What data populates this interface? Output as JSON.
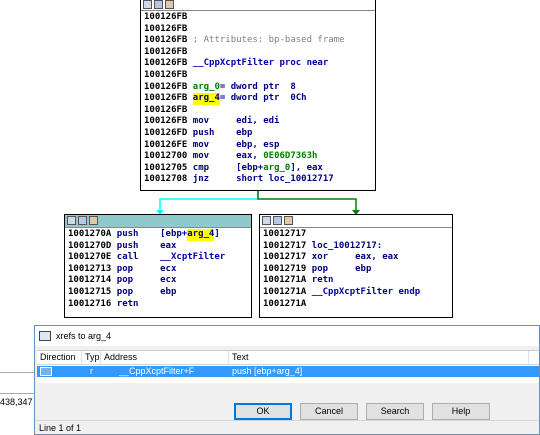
{
  "top_node": {
    "lines": [
      {
        "addr": "100126FB",
        "parts": []
      },
      {
        "addr": "100126FB",
        "parts": []
      },
      {
        "addr": "100126FB",
        "parts": [
          {
            "t": "; Attributes: bp-based frame",
            "c": "cmt"
          }
        ]
      },
      {
        "addr": "100126FB",
        "parts": []
      },
      {
        "addr": "100126FB",
        "parts": [
          {
            "t": "__CppXcptFilter proc near",
            "c": "proc"
          }
        ]
      },
      {
        "addr": "100126FB",
        "parts": []
      },
      {
        "addr": "100126FB",
        "parts": [
          {
            "t": "arg_0",
            "c": "num"
          },
          {
            "t": "= dword ptr  8",
            "c": "op"
          }
        ]
      },
      {
        "addr": "100126FB",
        "parts": [
          {
            "t": "arg_4",
            "c": "ylw"
          },
          {
            "t": "= dword ptr  0Ch",
            "c": "op"
          }
        ]
      },
      {
        "addr": "100126FB",
        "parts": []
      },
      {
        "addr": "100126FB",
        "parts": [
          {
            "t": "mov     edi, edi",
            "c": "mn"
          }
        ]
      },
      {
        "addr": "100126FD",
        "parts": [
          {
            "t": "push    ebp",
            "c": "mn"
          }
        ]
      },
      {
        "addr": "100126FE",
        "parts": [
          {
            "t": "mov     ebp, esp",
            "c": "mn"
          }
        ]
      },
      {
        "addr": "10012700",
        "parts": [
          {
            "t": "mov     eax, ",
            "c": "mn"
          },
          {
            "t": "0E06D7363h",
            "c": "num"
          }
        ]
      },
      {
        "addr": "10012705",
        "parts": [
          {
            "t": "cmp     [ebp+",
            "c": "mn"
          },
          {
            "t": "arg_0",
            "c": "num"
          },
          {
            "t": "], eax",
            "c": "mn"
          }
        ]
      },
      {
        "addr": "10012708",
        "parts": [
          {
            "t": "jnz     short loc_10012717",
            "c": "mn"
          }
        ]
      }
    ]
  },
  "left_node": {
    "lines": [
      {
        "addr": "1001270A",
        "parts": [
          {
            "t": "push    [ebp+",
            "c": "mn"
          },
          {
            "t": "arg_4",
            "c": "ylw"
          },
          {
            "t": "]",
            "c": "mn"
          }
        ]
      },
      {
        "addr": "1001270D",
        "parts": [
          {
            "t": "push    eax",
            "c": "mn"
          }
        ]
      },
      {
        "addr": "1001270E",
        "parts": [
          {
            "t": "call    ",
            "c": "mn"
          },
          {
            "t": "__XcptFilter",
            "c": "proc"
          }
        ]
      },
      {
        "addr": "10012713",
        "parts": [
          {
            "t": "pop     ecx",
            "c": "mn"
          }
        ]
      },
      {
        "addr": "10012714",
        "parts": [
          {
            "t": "pop     ecx",
            "c": "mn"
          }
        ]
      },
      {
        "addr": "10012715",
        "parts": [
          {
            "t": "pop     ebp",
            "c": "mn"
          }
        ]
      },
      {
        "addr": "10012716",
        "parts": [
          {
            "t": "retn",
            "c": "mn"
          }
        ]
      }
    ]
  },
  "right_node": {
    "lines": [
      {
        "addr": "10012717",
        "parts": []
      },
      {
        "addr": "10012717",
        "parts": [
          {
            "t": "loc_10012717:",
            "c": "mn"
          }
        ]
      },
      {
        "addr": "10012717",
        "parts": [
          {
            "t": "xor     eax, eax",
            "c": "mn"
          }
        ]
      },
      {
        "addr": "10012719",
        "parts": [
          {
            "t": "pop     ebp",
            "c": "mn"
          }
        ]
      },
      {
        "addr": "1001271A",
        "parts": [
          {
            "t": "retn",
            "c": "mn"
          }
        ]
      },
      {
        "addr": "1001271A",
        "parts": [
          {
            "t": "__CppXcptFilter endp",
            "c": "proc"
          }
        ]
      },
      {
        "addr": "1001271A",
        "parts": []
      }
    ]
  },
  "colors": {
    "true_edge": "#00ffff",
    "false_edge": "#008000",
    "selection": "#3399ff"
  },
  "coords_text": "438,347",
  "dialog": {
    "title": "xrefs to arg_4",
    "columns": {
      "direction": "Direction",
      "type": "Typ",
      "address": "Address",
      "text": "Text"
    },
    "rows": [
      {
        "direction": "",
        "type": "r",
        "address": "__CppXcptFilter+F",
        "text": "push    [ebp+arg_4]"
      }
    ],
    "buttons": {
      "ok": "OK",
      "cancel": "Cancel",
      "search": "Search",
      "help": "Help"
    },
    "status": "Line 1 of 1"
  }
}
